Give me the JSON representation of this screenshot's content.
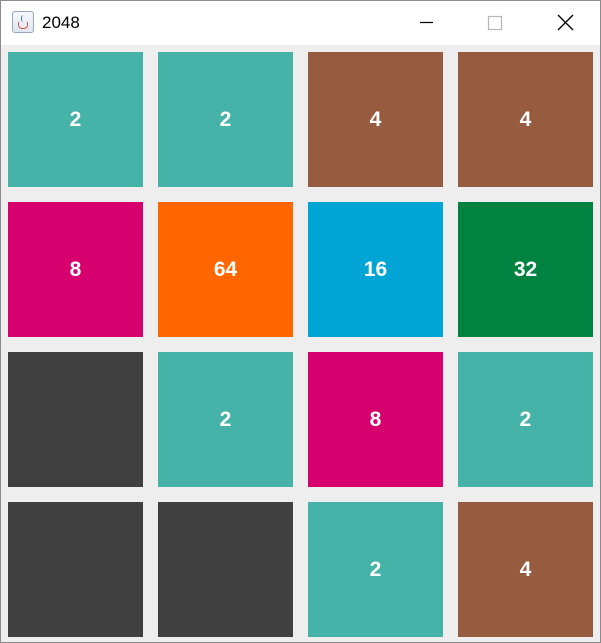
{
  "window": {
    "title": "2048",
    "icon": "java-cup-icon",
    "controls": [
      "minimize-icon",
      "maximize-icon",
      "close-icon"
    ]
  },
  "board": {
    "size": 4,
    "rows": [
      [
        {
          "label": "2",
          "color": "#46b3a9"
        },
        {
          "label": "2",
          "color": "#46b3a9"
        },
        {
          "label": "4",
          "color": "#975c3f"
        },
        {
          "label": "4",
          "color": "#975c3f"
        }
      ],
      [
        {
          "label": "8",
          "color": "#d6006f"
        },
        {
          "label": "64",
          "color": "#ff6600"
        },
        {
          "label": "16",
          "color": "#00a5d6"
        },
        {
          "label": "32",
          "color": "#008240"
        }
      ],
      [
        {
          "label": "",
          "color": "#404040"
        },
        {
          "label": "2",
          "color": "#46b3a9"
        },
        {
          "label": "8",
          "color": "#d6006f"
        },
        {
          "label": "2",
          "color": "#46b3a9"
        }
      ],
      [
        {
          "label": "",
          "color": "#404040"
        },
        {
          "label": "",
          "color": "#404040"
        },
        {
          "label": "2",
          "color": "#46b3a9"
        },
        {
          "label": "4",
          "color": "#975c3f"
        }
      ]
    ]
  }
}
